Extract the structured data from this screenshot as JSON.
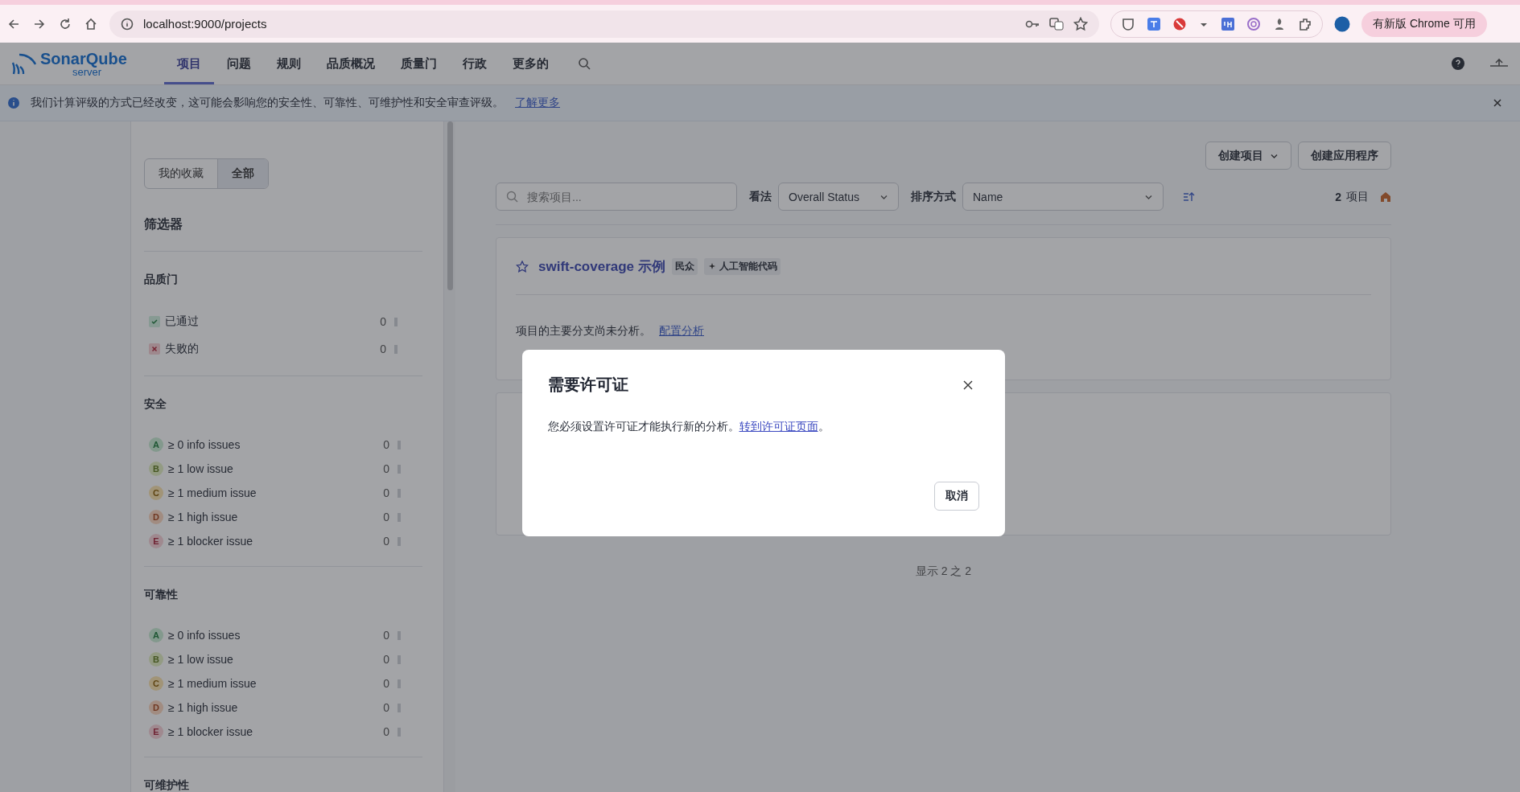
{
  "browser": {
    "url": "localhost:9000/projects",
    "update_notice": "有新版 Chrome 可用"
  },
  "header": {
    "logo": {
      "name": "SonarQube",
      "subtitle": "server"
    },
    "nav": [
      {
        "label": "项目",
        "selected": true
      },
      {
        "label": "问题",
        "selected": false
      },
      {
        "label": "规则",
        "selected": false
      },
      {
        "label": "品质概况",
        "selected": false
      },
      {
        "label": "质量门",
        "selected": false
      },
      {
        "label": "行政",
        "selected": false
      },
      {
        "label": "更多的",
        "selected": false
      }
    ]
  },
  "banner": {
    "text": "我们计算评级的方式已经改变，这可能会影响您的安全性、可靠性、可维护性和安全审查评级。",
    "link": "了解更多"
  },
  "sidebar": {
    "toggle": [
      {
        "label": "我的收藏",
        "selected": false
      },
      {
        "label": "全部",
        "selected": true
      }
    ],
    "title": "筛选器",
    "sections": [
      {
        "title": "品质门",
        "items": [
          {
            "kind": "passed",
            "label": "已通过",
            "count": "0"
          },
          {
            "kind": "failed",
            "label": "失败的",
            "count": "0"
          }
        ]
      },
      {
        "title": "安全",
        "items": [
          {
            "kind": "gradea",
            "rating": "A",
            "label": "≥ 0 info issues",
            "count": "0"
          },
          {
            "kind": "gradeb",
            "rating": "B",
            "label": "≥ 1 low issue",
            "count": "0"
          },
          {
            "kind": "gradec",
            "rating": "C",
            "label": "≥ 1 medium issue",
            "count": "0"
          },
          {
            "kind": "graded",
            "rating": "D",
            "label": "≥ 1 high issue",
            "count": "0"
          },
          {
            "kind": "gradee",
            "rating": "E",
            "label": "≥ 1 blocker issue",
            "count": "0"
          }
        ]
      },
      {
        "title": "可靠性",
        "items": [
          {
            "kind": "gradea",
            "rating": "A",
            "label": "≥ 0 info issues",
            "count": "0"
          },
          {
            "kind": "gradeb",
            "rating": "B",
            "label": "≥ 1 low issue",
            "count": "0"
          },
          {
            "kind": "gradec",
            "rating": "C",
            "label": "≥ 1 medium issue",
            "count": "0"
          },
          {
            "kind": "graded",
            "rating": "D",
            "label": "≥ 1 high issue",
            "count": "0"
          },
          {
            "kind": "gradee",
            "rating": "E",
            "label": "≥ 1 blocker issue",
            "count": "0"
          }
        ]
      },
      {
        "title": "可维护性"
      }
    ]
  },
  "main": {
    "actions": [
      {
        "label": "创建项目",
        "dropdown": true
      },
      {
        "label": "创建应用程序",
        "dropdown": false
      }
    ],
    "search": {
      "placeholder": "搜索项目..."
    },
    "view": {
      "label": "看法",
      "value": "Overall Status"
    },
    "sort": {
      "label": "排序方式",
      "value": "Name"
    },
    "count": "2",
    "count_label": "项目",
    "projects": [
      {
        "name": "swift-coverage 示例",
        "favorite": false,
        "tags": [
          {
            "kind": "plain",
            "label": "民众"
          },
          {
            "kind": "ai",
            "label": "人工智能代码"
          }
        ],
        "message": "项目的主要分支尚未分析。",
        "link": "配置分析"
      },
      {
        "kind": "covered"
      }
    ],
    "pagination": "显示 2 之 2"
  },
  "modal": {
    "title": "需要许可证",
    "text": "您必须设置许可证才能执行新的分析。",
    "link": "转到许可证页面",
    "suffix": "。",
    "buttons": [
      "取消"
    ]
  }
}
